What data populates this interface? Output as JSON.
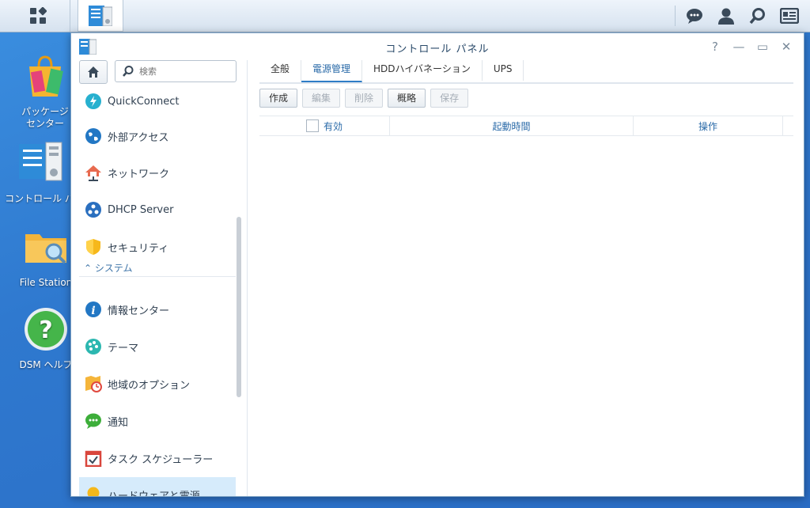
{
  "taskbar": {
    "main_menu_icon": "grid-icon",
    "app_icon": "control-panel-icon",
    "right_icons": [
      "chat-icon",
      "user-icon",
      "search-icon",
      "widgets-icon"
    ]
  },
  "desktop": {
    "icons": [
      {
        "label": "パッケージ\nセンター",
        "icon": "package-center-icon"
      },
      {
        "label": "コントロール パ",
        "icon": "control-panel-icon"
      },
      {
        "label": "File Station",
        "icon": "file-station-icon"
      },
      {
        "label": "DSM ヘルプ",
        "icon": "help-icon"
      }
    ]
  },
  "window": {
    "title": "コントロール パネル",
    "controls": {
      "help": "?",
      "minimize": "—",
      "maximize": "▭",
      "close": "✕"
    }
  },
  "sidebar": {
    "search_placeholder": "検索",
    "items_top": [
      {
        "label": "QuickConnect",
        "icon": "quickconnect-icon"
      },
      {
        "label": "外部アクセス",
        "icon": "external-access-icon"
      },
      {
        "label": "ネットワーク",
        "icon": "network-icon"
      },
      {
        "label": "DHCP Server",
        "icon": "dhcp-icon"
      },
      {
        "label": "セキュリティ",
        "icon": "security-icon"
      }
    ],
    "section_label": "システム",
    "items_system": [
      {
        "label": "情報センター",
        "icon": "info-icon"
      },
      {
        "label": "テーマ",
        "icon": "theme-icon"
      },
      {
        "label": "地域のオプション",
        "icon": "regional-options-icon"
      },
      {
        "label": "通知",
        "icon": "notification-icon"
      },
      {
        "label": "タスク スケジューラー",
        "icon": "task-scheduler-icon"
      },
      {
        "label": "ハードウェアと電源",
        "icon": "hardware-power-icon",
        "active": true
      }
    ]
  },
  "main": {
    "tabs": [
      {
        "label": "全般"
      },
      {
        "label": "電源管理",
        "active": true
      },
      {
        "label": "HDDハイバネーション"
      },
      {
        "label": "UPS"
      }
    ],
    "toolbar": {
      "create": "作成",
      "edit": "編集",
      "delete": "削除",
      "summary": "概略",
      "save": "保存"
    },
    "grid": {
      "columns": [
        "有効",
        "起動時間",
        "操作"
      ]
    }
  }
}
